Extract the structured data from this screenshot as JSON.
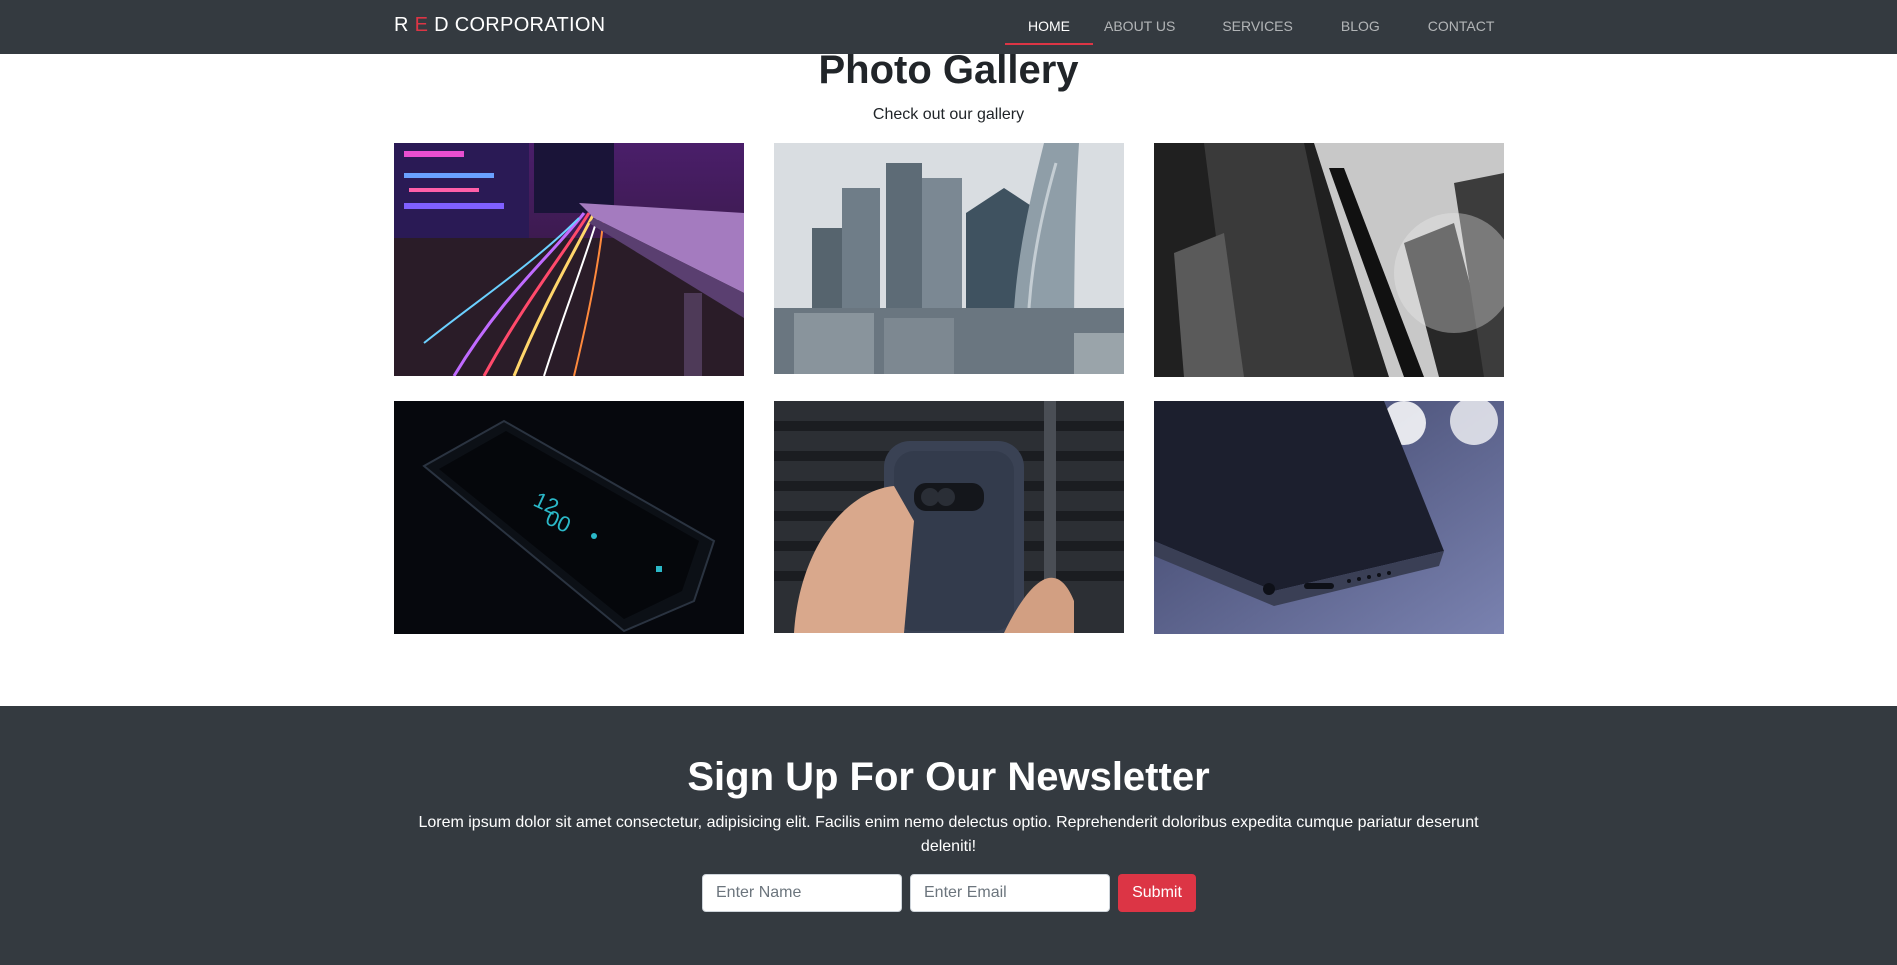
{
  "navbar": {
    "brand": {
      "part1": "R ",
      "accent": "E",
      "part2": " D CORPORATION"
    },
    "items": [
      {
        "label": "HOME",
        "active": true
      },
      {
        "label": "ABOUT US",
        "active": false
      },
      {
        "label": "SERVICES",
        "active": false
      },
      {
        "label": "BLOG",
        "active": false
      },
      {
        "label": "CONTACT",
        "active": false
      }
    ]
  },
  "gallery": {
    "title": "Photo Gallery",
    "subtitle": "Check out our gallery",
    "images": [
      {
        "subject": "city-night-light-trails-photo"
      },
      {
        "subject": "skyscrapers-photo"
      },
      {
        "subject": "grayscale-buildings-photo"
      },
      {
        "subject": "dark-smartphone-clock-photo"
      },
      {
        "subject": "hand-holding-phone-photo"
      },
      {
        "subject": "iphone-closeup-photo"
      }
    ]
  },
  "newsletter": {
    "title": "Sign Up For Our Newsletter",
    "text": "Lorem ipsum dolor sit amet consectetur, adipisicing elit. Facilis enim nemo delectus optio. Reprehenderit doloribus expedita cumque pariatur deserunt deleniti!",
    "name_placeholder": "Enter Name",
    "email_placeholder": "Enter Email",
    "submit_label": "Submit"
  },
  "colors": {
    "dark": "#343a40",
    "accent": "#dc3545",
    "text": "#212529"
  }
}
